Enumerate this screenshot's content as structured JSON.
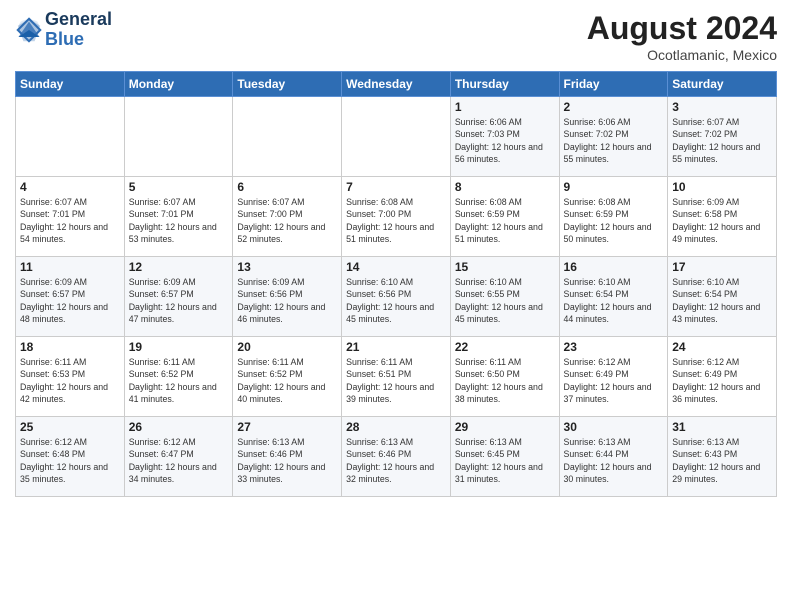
{
  "logo": {
    "text_general": "General",
    "text_blue": "Blue"
  },
  "header": {
    "month_year": "August 2024",
    "location": "Ocotlamanic, Mexico"
  },
  "weekdays": [
    "Sunday",
    "Monday",
    "Tuesday",
    "Wednesday",
    "Thursday",
    "Friday",
    "Saturday"
  ],
  "weeks": [
    [
      {
        "day": "",
        "sunrise": "",
        "sunset": "",
        "daylight": ""
      },
      {
        "day": "",
        "sunrise": "",
        "sunset": "",
        "daylight": ""
      },
      {
        "day": "",
        "sunrise": "",
        "sunset": "",
        "daylight": ""
      },
      {
        "day": "",
        "sunrise": "",
        "sunset": "",
        "daylight": ""
      },
      {
        "day": "1",
        "sunrise": "Sunrise: 6:06 AM",
        "sunset": "Sunset: 7:03 PM",
        "daylight": "Daylight: 12 hours and 56 minutes."
      },
      {
        "day": "2",
        "sunrise": "Sunrise: 6:06 AM",
        "sunset": "Sunset: 7:02 PM",
        "daylight": "Daylight: 12 hours and 55 minutes."
      },
      {
        "day": "3",
        "sunrise": "Sunrise: 6:07 AM",
        "sunset": "Sunset: 7:02 PM",
        "daylight": "Daylight: 12 hours and 55 minutes."
      }
    ],
    [
      {
        "day": "4",
        "sunrise": "Sunrise: 6:07 AM",
        "sunset": "Sunset: 7:01 PM",
        "daylight": "Daylight: 12 hours and 54 minutes."
      },
      {
        "day": "5",
        "sunrise": "Sunrise: 6:07 AM",
        "sunset": "Sunset: 7:01 PM",
        "daylight": "Daylight: 12 hours and 53 minutes."
      },
      {
        "day": "6",
        "sunrise": "Sunrise: 6:07 AM",
        "sunset": "Sunset: 7:00 PM",
        "daylight": "Daylight: 12 hours and 52 minutes."
      },
      {
        "day": "7",
        "sunrise": "Sunrise: 6:08 AM",
        "sunset": "Sunset: 7:00 PM",
        "daylight": "Daylight: 12 hours and 51 minutes."
      },
      {
        "day": "8",
        "sunrise": "Sunrise: 6:08 AM",
        "sunset": "Sunset: 6:59 PM",
        "daylight": "Daylight: 12 hours and 51 minutes."
      },
      {
        "day": "9",
        "sunrise": "Sunrise: 6:08 AM",
        "sunset": "Sunset: 6:59 PM",
        "daylight": "Daylight: 12 hours and 50 minutes."
      },
      {
        "day": "10",
        "sunrise": "Sunrise: 6:09 AM",
        "sunset": "Sunset: 6:58 PM",
        "daylight": "Daylight: 12 hours and 49 minutes."
      }
    ],
    [
      {
        "day": "11",
        "sunrise": "Sunrise: 6:09 AM",
        "sunset": "Sunset: 6:57 PM",
        "daylight": "Daylight: 12 hours and 48 minutes."
      },
      {
        "day": "12",
        "sunrise": "Sunrise: 6:09 AM",
        "sunset": "Sunset: 6:57 PM",
        "daylight": "Daylight: 12 hours and 47 minutes."
      },
      {
        "day": "13",
        "sunrise": "Sunrise: 6:09 AM",
        "sunset": "Sunset: 6:56 PM",
        "daylight": "Daylight: 12 hours and 46 minutes."
      },
      {
        "day": "14",
        "sunrise": "Sunrise: 6:10 AM",
        "sunset": "Sunset: 6:56 PM",
        "daylight": "Daylight: 12 hours and 45 minutes."
      },
      {
        "day": "15",
        "sunrise": "Sunrise: 6:10 AM",
        "sunset": "Sunset: 6:55 PM",
        "daylight": "Daylight: 12 hours and 45 minutes."
      },
      {
        "day": "16",
        "sunrise": "Sunrise: 6:10 AM",
        "sunset": "Sunset: 6:54 PM",
        "daylight": "Daylight: 12 hours and 44 minutes."
      },
      {
        "day": "17",
        "sunrise": "Sunrise: 6:10 AM",
        "sunset": "Sunset: 6:54 PM",
        "daylight": "Daylight: 12 hours and 43 minutes."
      }
    ],
    [
      {
        "day": "18",
        "sunrise": "Sunrise: 6:11 AM",
        "sunset": "Sunset: 6:53 PM",
        "daylight": "Daylight: 12 hours and 42 minutes."
      },
      {
        "day": "19",
        "sunrise": "Sunrise: 6:11 AM",
        "sunset": "Sunset: 6:52 PM",
        "daylight": "Daylight: 12 hours and 41 minutes."
      },
      {
        "day": "20",
        "sunrise": "Sunrise: 6:11 AM",
        "sunset": "Sunset: 6:52 PM",
        "daylight": "Daylight: 12 hours and 40 minutes."
      },
      {
        "day": "21",
        "sunrise": "Sunrise: 6:11 AM",
        "sunset": "Sunset: 6:51 PM",
        "daylight": "Daylight: 12 hours and 39 minutes."
      },
      {
        "day": "22",
        "sunrise": "Sunrise: 6:11 AM",
        "sunset": "Sunset: 6:50 PM",
        "daylight": "Daylight: 12 hours and 38 minutes."
      },
      {
        "day": "23",
        "sunrise": "Sunrise: 6:12 AM",
        "sunset": "Sunset: 6:49 PM",
        "daylight": "Daylight: 12 hours and 37 minutes."
      },
      {
        "day": "24",
        "sunrise": "Sunrise: 6:12 AM",
        "sunset": "Sunset: 6:49 PM",
        "daylight": "Daylight: 12 hours and 36 minutes."
      }
    ],
    [
      {
        "day": "25",
        "sunrise": "Sunrise: 6:12 AM",
        "sunset": "Sunset: 6:48 PM",
        "daylight": "Daylight: 12 hours and 35 minutes."
      },
      {
        "day": "26",
        "sunrise": "Sunrise: 6:12 AM",
        "sunset": "Sunset: 6:47 PM",
        "daylight": "Daylight: 12 hours and 34 minutes."
      },
      {
        "day": "27",
        "sunrise": "Sunrise: 6:13 AM",
        "sunset": "Sunset: 6:46 PM",
        "daylight": "Daylight: 12 hours and 33 minutes."
      },
      {
        "day": "28",
        "sunrise": "Sunrise: 6:13 AM",
        "sunset": "Sunset: 6:46 PM",
        "daylight": "Daylight: 12 hours and 32 minutes."
      },
      {
        "day": "29",
        "sunrise": "Sunrise: 6:13 AM",
        "sunset": "Sunset: 6:45 PM",
        "daylight": "Daylight: 12 hours and 31 minutes."
      },
      {
        "day": "30",
        "sunrise": "Sunrise: 6:13 AM",
        "sunset": "Sunset: 6:44 PM",
        "daylight": "Daylight: 12 hours and 30 minutes."
      },
      {
        "day": "31",
        "sunrise": "Sunrise: 6:13 AM",
        "sunset": "Sunset: 6:43 PM",
        "daylight": "Daylight: 12 hours and 29 minutes."
      }
    ]
  ]
}
